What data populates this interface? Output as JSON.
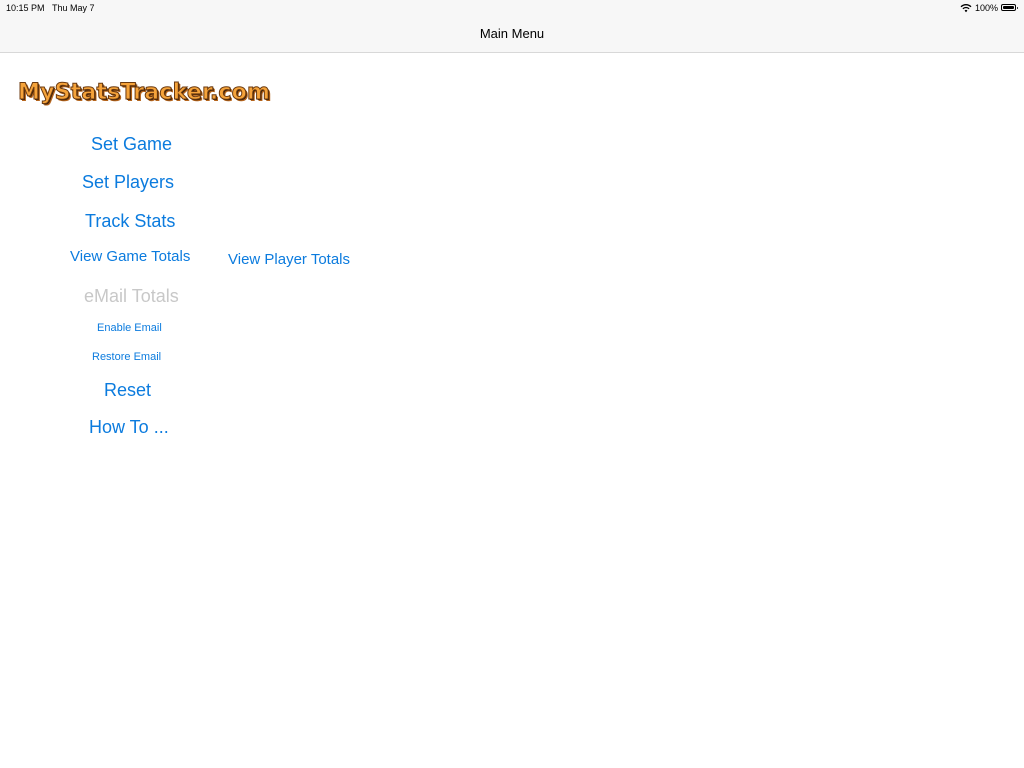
{
  "status_bar": {
    "time": "10:15 PM",
    "date": "Thu May 7",
    "battery_percent": "100%",
    "battery_level": 1.0
  },
  "nav": {
    "title": "Main Menu"
  },
  "logo": {
    "text": "MyStatsTracker.com"
  },
  "menu": {
    "set_game": "Set Game",
    "set_players": "Set Players",
    "track_stats": "Track Stats",
    "view_game_totals": "View Game Totals",
    "view_player_totals": "View Player Totals",
    "email_totals": "eMail Totals",
    "enable_email": "Enable Email",
    "restore_email": "Restore Email",
    "reset": "Reset",
    "how_to": "How To ..."
  },
  "colors": {
    "accent": "#0b7bde",
    "disabled": "#c8c8c8",
    "logo_fill": "#f5a33a",
    "logo_outline": "#6b3a10"
  },
  "icons": {
    "wifi": "wifi-icon",
    "battery": "battery-icon"
  }
}
